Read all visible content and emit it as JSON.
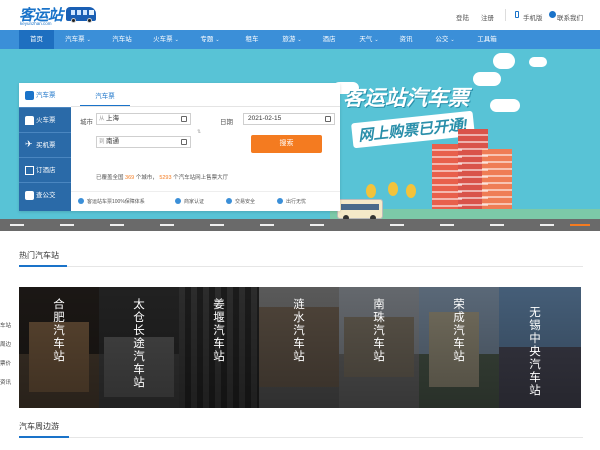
{
  "header": {
    "logo_text": "客运站",
    "logo_sub": "keyunzhan.com",
    "login": "登陆",
    "register": "注册",
    "mobile": "手机版",
    "contact": "联系我们"
  },
  "nav": [
    {
      "label": "首页",
      "chev": ""
    },
    {
      "label": "汽车票",
      "chev": "⌄"
    },
    {
      "label": "汽车站",
      "chev": ""
    },
    {
      "label": "火车票",
      "chev": "⌄"
    },
    {
      "label": "专题",
      "chev": "⌄"
    },
    {
      "label": "租车",
      "chev": ""
    },
    {
      "label": "旅游",
      "chev": "⌄"
    },
    {
      "label": "酒店",
      "chev": ""
    },
    {
      "label": "天气",
      "chev": "⌄"
    },
    {
      "label": "资讯",
      "chev": ""
    },
    {
      "label": "公交",
      "chev": "⌄"
    },
    {
      "label": "工具箱",
      "chev": ""
    }
  ],
  "banner": {
    "slogan1": "客运站汽车票",
    "slogan2": "网上购票已开通!"
  },
  "side_tabs": [
    "汽车票",
    "火车票",
    "买机票",
    "订酒店",
    "查公交"
  ],
  "form": {
    "tab": "汽车票",
    "city_label": "城市",
    "from_prefix": "从",
    "from_value": "上海",
    "to_prefix": "到",
    "to_value": "南通",
    "date_label": "日期",
    "date_value": "2021-02-15",
    "swap": "⇅",
    "search": "搜索",
    "stat_pre": "已覆盖全国",
    "stat_cities": "369",
    "stat_mid": "个城市，",
    "stat_stations": "5293",
    "stat_post": "个汽车站网上售票大厅",
    "features": [
      "客运站车票100%保障体系",
      "商家认证",
      "交易安全",
      "出行无忧"
    ]
  },
  "hot": {
    "title": "热门汽车站",
    "stations": [
      "合肥汽车站",
      "太仓长途汽车站",
      "姜堰汽车站",
      "涟水汽车站",
      "南珠汽车站",
      "荣成汽车站",
      "无锡中央汽车站"
    ]
  },
  "left_edge": [
    "车站",
    "周边",
    "票价",
    "资讯"
  ],
  "tour": {
    "title": "汽车周边游"
  }
}
